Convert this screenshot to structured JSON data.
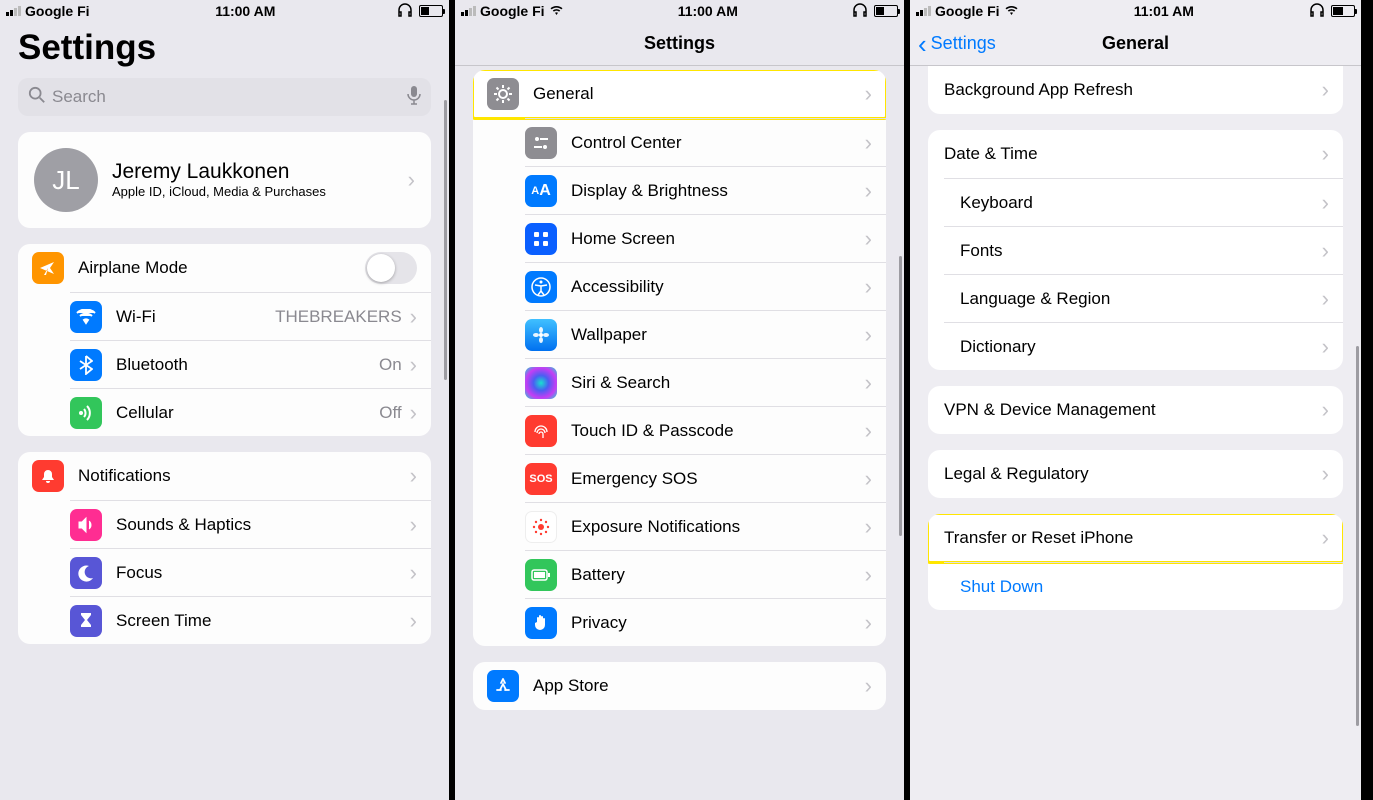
{
  "s1": {
    "status": {
      "carrier": "Google Fi",
      "time": "11:00 AM"
    },
    "title": "Settings",
    "search": {
      "placeholder": "Search"
    },
    "account": {
      "initials": "JL",
      "name": "Jeremy Laukkonen",
      "subtitle": "Apple ID, iCloud, Media & Purchases"
    },
    "net": {
      "airplane": "Airplane Mode",
      "wifi": "Wi-Fi",
      "wifi_value": "THEBREAKERS",
      "bt": "Bluetooth",
      "bt_value": "On",
      "cell": "Cellular",
      "cell_value": "Off"
    },
    "misc": {
      "notifications": "Notifications",
      "sounds": "Sounds & Haptics",
      "focus": "Focus",
      "screentime": "Screen Time"
    }
  },
  "s2": {
    "status": {
      "carrier": "Google Fi",
      "time": "11:00 AM"
    },
    "nav_title": "Settings",
    "items": {
      "general": "General",
      "control": "Control Center",
      "display": "Display & Brightness",
      "home": "Home Screen",
      "access": "Accessibility",
      "wallpaper": "Wallpaper",
      "siri": "Siri & Search",
      "touchid": "Touch ID & Passcode",
      "sos": "Emergency SOS",
      "exposure": "Exposure Notifications",
      "battery": "Battery",
      "privacy": "Privacy",
      "appstore": "App Store"
    }
  },
  "s3": {
    "status": {
      "carrier": "Google Fi",
      "time": "11:01 AM"
    },
    "back": "Settings",
    "nav_title": "General",
    "items": {
      "bar": "Background App Refresh",
      "date": "Date & Time",
      "keyboard": "Keyboard",
      "fonts": "Fonts",
      "lang": "Language & Region",
      "dict": "Dictionary",
      "vpn": "VPN & Device Management",
      "legal": "Legal & Regulatory",
      "transfer": "Transfer or Reset iPhone",
      "shutdown": "Shut Down"
    }
  }
}
